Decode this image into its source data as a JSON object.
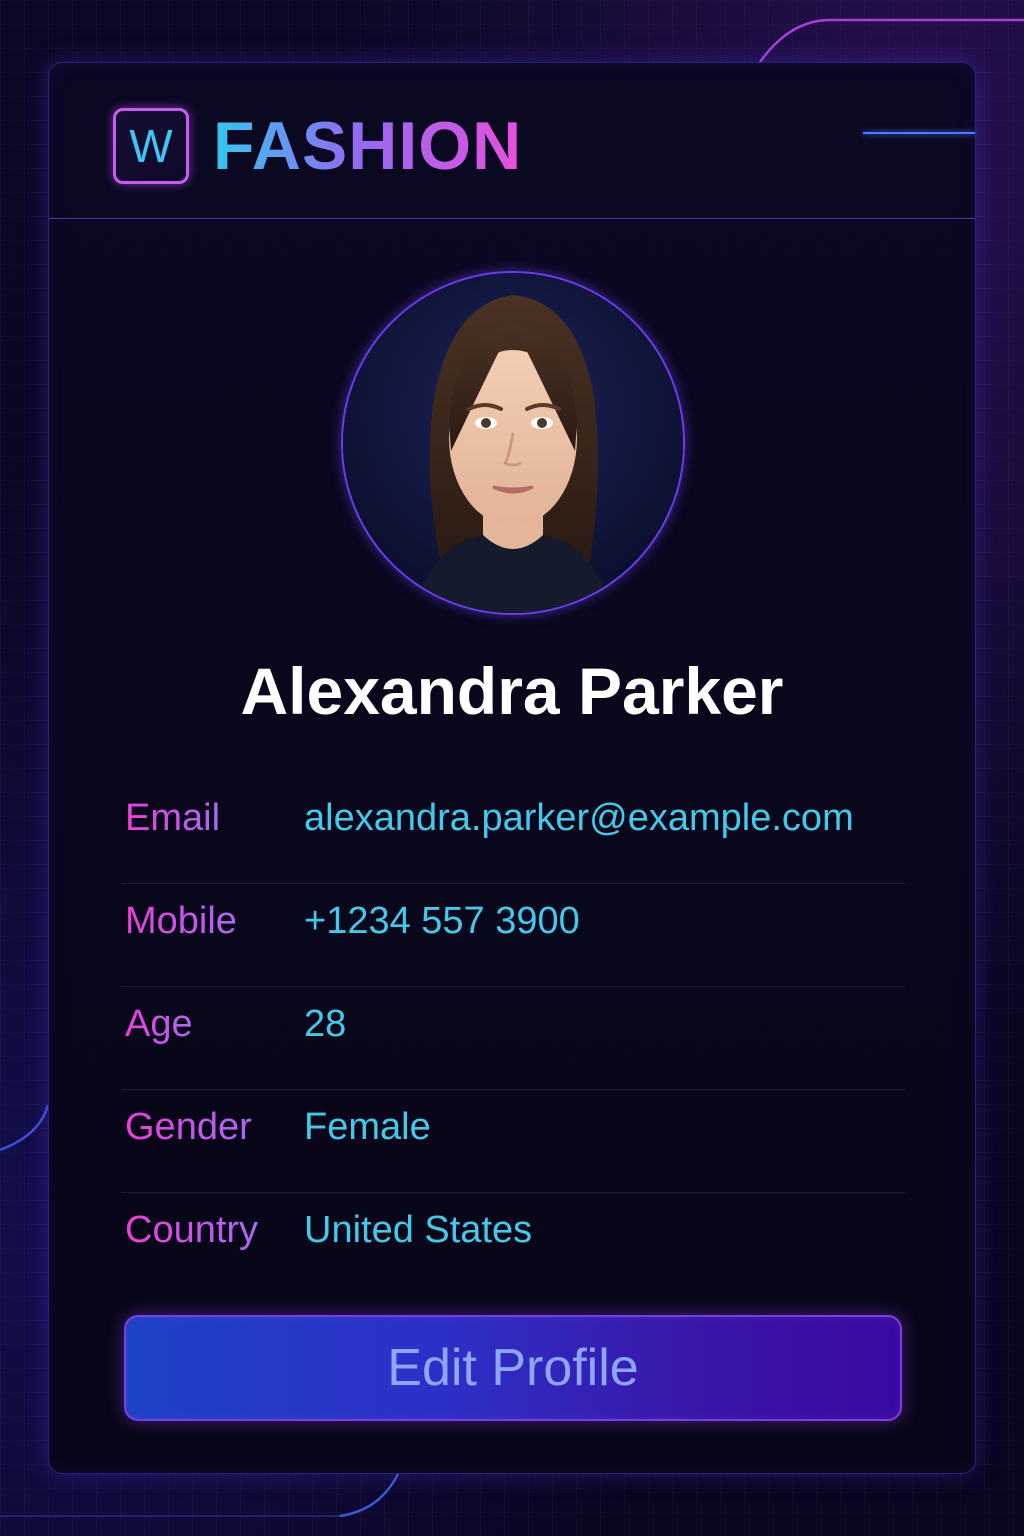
{
  "brand": {
    "logo_letter": "W",
    "name": "FASHION",
    "icon": "w-logo-icon"
  },
  "profile": {
    "name": "Alexandra Parker",
    "avatar": "avatar-photo",
    "fields": [
      {
        "label": "Email",
        "value": "alexandra.parker@example.com"
      },
      {
        "label": "Mobile",
        "value": "+1234 557 3900"
      },
      {
        "label": "Age",
        "value": "28"
      },
      {
        "label": "Gender",
        "value": "Female"
      },
      {
        "label": "Country",
        "value": "United States"
      }
    ]
  },
  "actions": {
    "edit_label": "Edit Profile"
  },
  "colors": {
    "background": "#0a0620",
    "card_border": "#463cc8",
    "label_gradient_start": "#ea40d6",
    "value": "#44c9e8",
    "button_start": "#1e42c8",
    "button_end": "#3a0aa0"
  }
}
